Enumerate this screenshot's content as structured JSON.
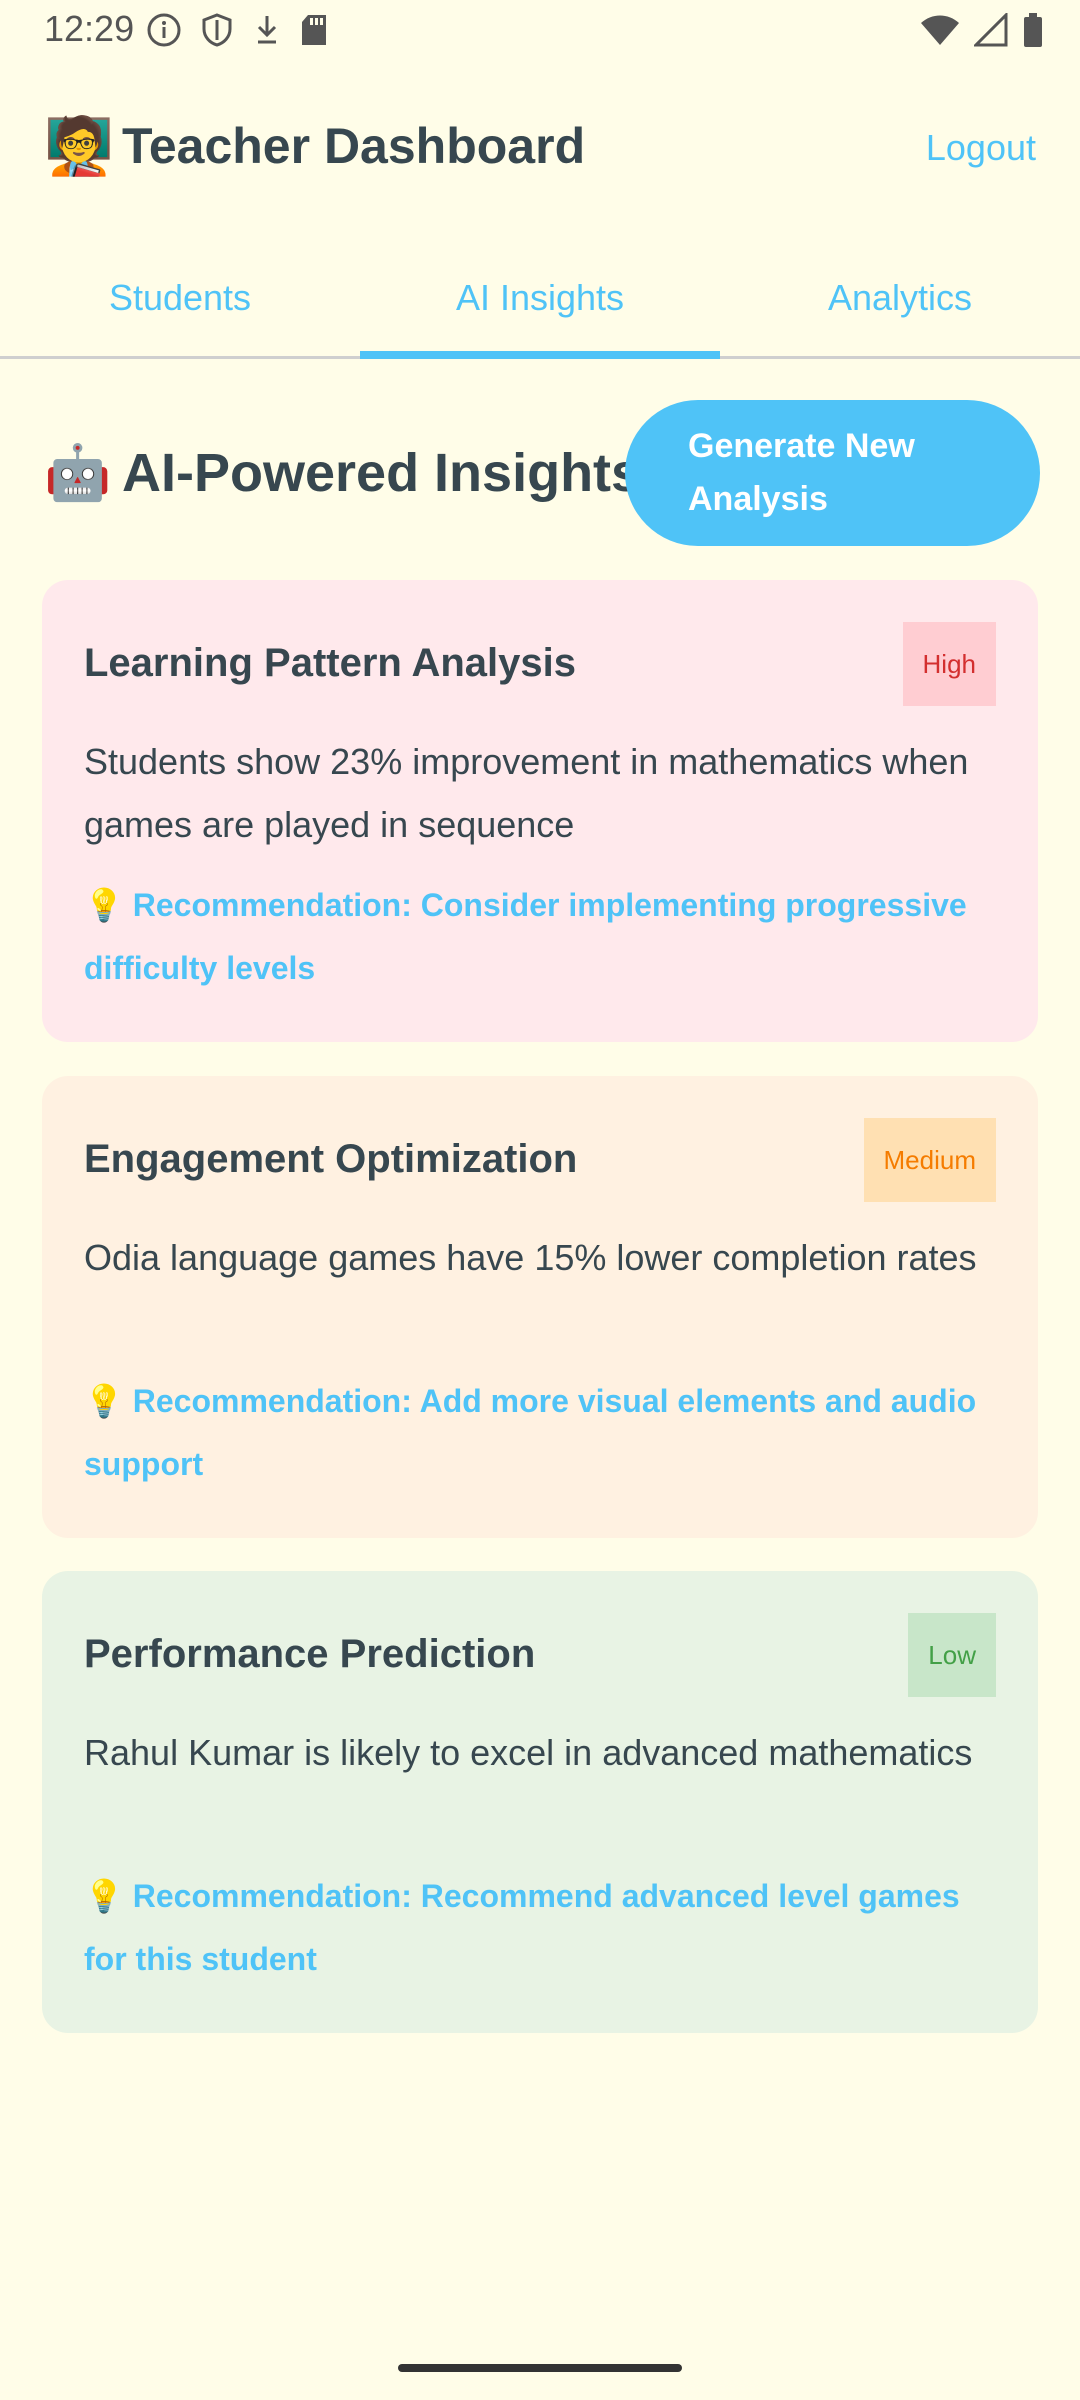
{
  "status_bar": {
    "time": "12:29",
    "left_icons": [
      "info-icon",
      "shield-icon",
      "download-icon",
      "sd-card-icon"
    ],
    "right_icons": [
      "wifi-icon",
      "signal-icon",
      "battery-icon"
    ]
  },
  "header": {
    "emoji": "🧑‍🏫",
    "title": "Teacher Dashboard",
    "logout_label": "Logout"
  },
  "tabs": [
    {
      "label": "Students",
      "active": false
    },
    {
      "label": "AI Insights",
      "active": true
    },
    {
      "label": "Analytics",
      "active": false
    }
  ],
  "section": {
    "emoji": "🤖",
    "title": "AI-Powered Insights",
    "generate_button_label": "Generate New Analysis"
  },
  "insights": [
    {
      "title": "Learning Pattern Analysis",
      "priority": "High",
      "description": "Students show 23% improvement in mathematics when games are played in sequence",
      "recommendation": "💡 Recommendation: Consider implementing progressive difficulty levels"
    },
    {
      "title": "Engagement Optimization",
      "priority": "Medium",
      "description": "Odia language games have 15% lower completion rates",
      "recommendation": "💡 Recommendation: Add more visual elements and audio support"
    },
    {
      "title": "Performance Prediction",
      "priority": "Low",
      "description": "Rahul Kumar is likely to excel in advanced mathematics",
      "recommendation": "💡 Recommendation: Recommend advanced level games for this student"
    }
  ],
  "colors": {
    "background": "#FFFDE8",
    "accent": "#4FC3F7",
    "text": "#37474F",
    "high_bg": "#FFE9EC",
    "high_badge": "#FFCDD2",
    "medium_bg": "#FFF1E1",
    "medium_badge": "#FFE0B2",
    "low_bg": "#E8F3E4",
    "low_badge": "#C8E6C9"
  }
}
